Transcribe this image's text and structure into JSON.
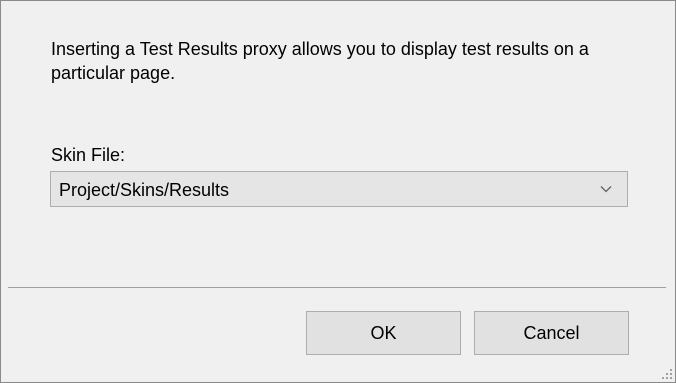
{
  "dialog": {
    "description": "Inserting a Test Results proxy allows you to display test results on a particular page.",
    "skin_file_label": "Skin File:",
    "skin_file_value": "Project/Skins/Results",
    "dropdown_icon": "chevron-down-icon",
    "ok_label": "OK",
    "cancel_label": "Cancel",
    "resize_grip_icon": "resize-grip-icon"
  }
}
